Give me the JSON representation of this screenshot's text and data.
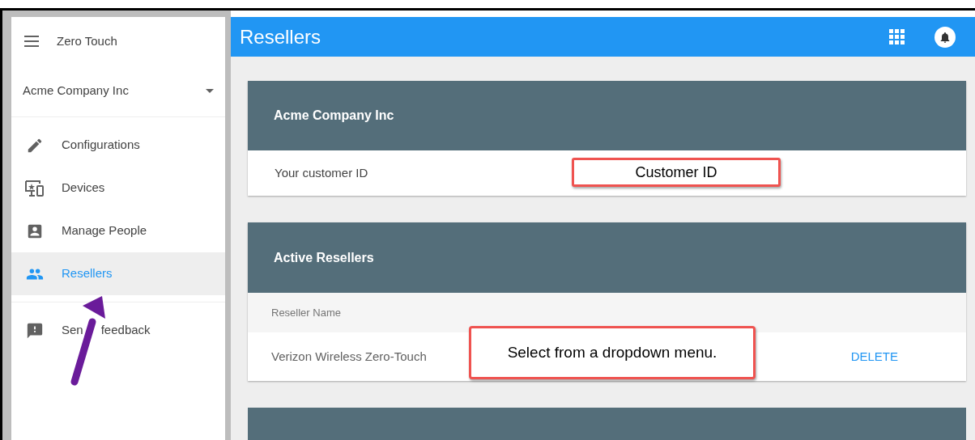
{
  "sidebar": {
    "title": "Zero Touch",
    "account": "Acme Company Inc",
    "items": [
      {
        "label": "Configurations",
        "kind": "pencil",
        "selected": false
      },
      {
        "label": "Devices",
        "kind": "devices",
        "selected": false
      },
      {
        "label": "Manage People",
        "kind": "person",
        "selected": false
      },
      {
        "label": "Resellers",
        "kind": "people",
        "selected": true
      }
    ],
    "footer_items": [
      {
        "label_parts": [
          "Sen",
          "feedback"
        ],
        "kind": "feedback"
      }
    ]
  },
  "header": {
    "title": "Resellers"
  },
  "customer_card": {
    "title": "Acme Company Inc",
    "label": "Your customer ID"
  },
  "resellers_card": {
    "title": "Active Resellers",
    "column": "Reseller Name",
    "rows": [
      {
        "name": "Verizon Wireless Zero-Touch",
        "action": "DELETE"
      }
    ]
  },
  "callouts": [
    {
      "text": "Customer ID"
    },
    {
      "text": "Select from a dropdown menu."
    }
  ]
}
